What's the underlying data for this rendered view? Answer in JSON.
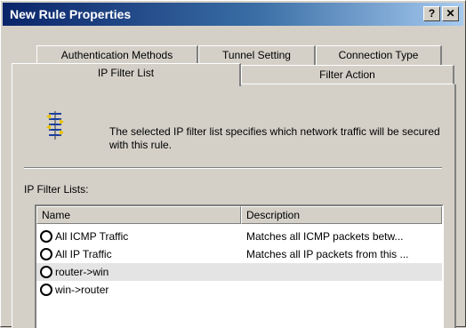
{
  "window": {
    "title": "New Rule Properties",
    "help_label": "?",
    "close_label": "✕"
  },
  "tabs": {
    "back_row": [
      "Authentication Methods",
      "Tunnel Setting",
      "Connection Type"
    ],
    "front_row": [
      "IP Filter List",
      "Filter Action"
    ],
    "active": "IP Filter List"
  },
  "content": {
    "icon": "ip-filter-list-icon",
    "description": "The selected IP filter list specifies which network traffic will be secured with this rule.",
    "list_label": "IP Filter Lists:"
  },
  "filter_list": {
    "columns": [
      "Name",
      "Description"
    ],
    "rows": [
      {
        "name": "All ICMP Traffic",
        "description": "Matches all ICMP packets betw...",
        "selected": false
      },
      {
        "name": "All IP Traffic",
        "description": "Matches all IP packets from this ...",
        "selected": false
      },
      {
        "name": "router->win",
        "description": "",
        "selected": true
      },
      {
        "name": "win->router",
        "description": "",
        "selected": false
      }
    ]
  }
}
